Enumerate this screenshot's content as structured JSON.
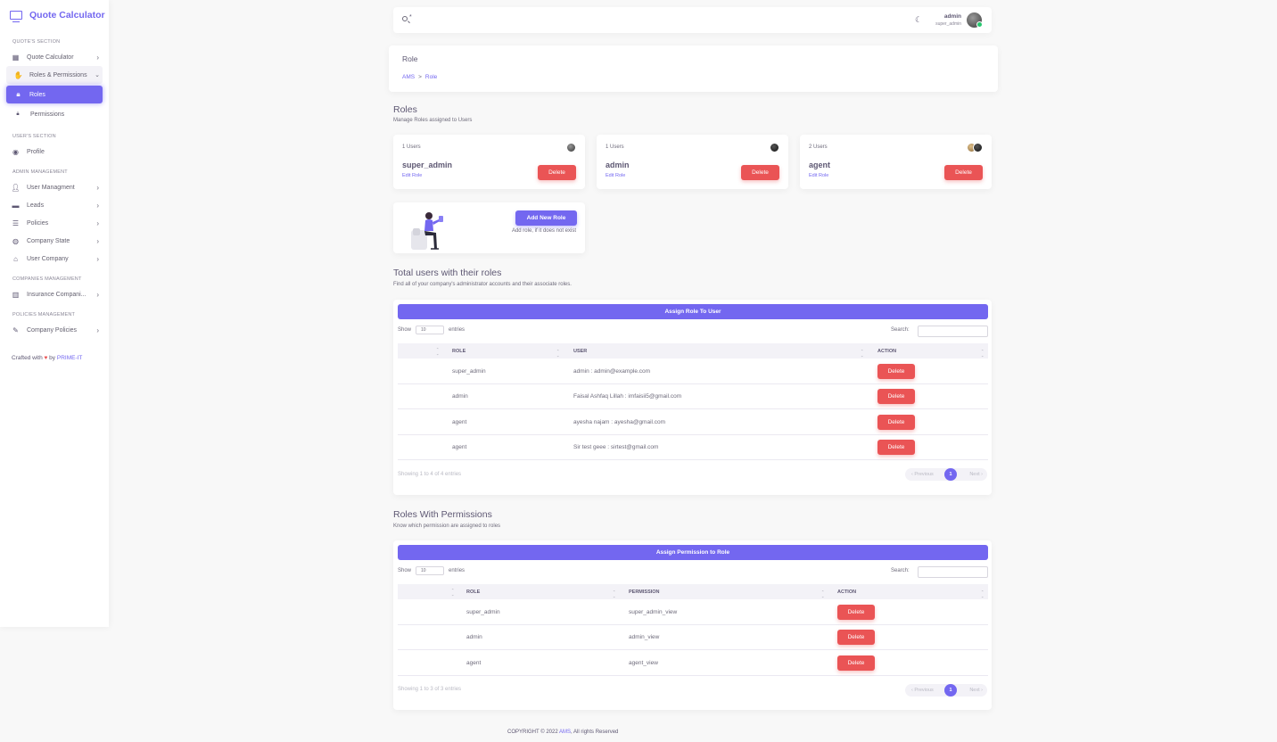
{
  "brand": {
    "title": "Quote Calculator"
  },
  "sidebar": {
    "quote_section": "QUOTE'S SECTION",
    "users_section": "USER'S SECTION",
    "admin_section": "ADMIN MANAGEMENT",
    "companies_section": "COMPANIES MANAGEMENT",
    "policies_section": "POLICIES MANAGEMENT",
    "items": {
      "quote_calculator": "Quote Calculator",
      "roles_permissions": "Roles & Permissions",
      "roles": "Roles",
      "permissions": "Permissions",
      "profile": "Profile",
      "user_management": "User Managment",
      "leads": "Leads",
      "policies": "Policies",
      "company_state": "Company State",
      "user_company": "User Company",
      "insurance_companies": "Insurance Compani...",
      "company_policies": "Company Policies"
    },
    "crafted_prefix": "Crafted with",
    "crafted_by": "by",
    "crafted_link": "PRIME-IT"
  },
  "navbar": {
    "star": "*",
    "user_name": "admin",
    "user_role": "super_admin"
  },
  "breadcrumb": {
    "title": "Role",
    "home": "AMS",
    "sep": ">",
    "current": "Role"
  },
  "roles_header": {
    "title": "Roles",
    "subtitle": "Manage Roles assigned to Users"
  },
  "role_cards": [
    {
      "count": "1 Users",
      "name": "super_admin",
      "edit": "Edit Role",
      "delete": "Delete"
    },
    {
      "count": "1 Users",
      "name": "admin",
      "edit": "Edit Role",
      "delete": "Delete"
    },
    {
      "count": "2 Users",
      "name": "agent",
      "edit": "Edit Role",
      "delete": "Delete"
    }
  ],
  "add_role": {
    "button": "Add New Role",
    "help": "Add role, if it does not exist"
  },
  "users_roles": {
    "title": "Total users with their roles",
    "subtitle": "Find all of your company's administrator accounts and their associate roles.",
    "assign_button": "Assign Role To User",
    "show": "Show",
    "entries_value": "10",
    "entries": "entries",
    "search": "Search:",
    "columns": [
      "ROLE",
      "USER",
      "ACTION"
    ],
    "rows": [
      {
        "role": "super_admin",
        "user": "admin : admin@example.com",
        "action": "Delete"
      },
      {
        "role": "admin",
        "user": "Faisal Ashfaq Lillah : imfaisii5@gmail.com",
        "action": "Delete"
      },
      {
        "role": "agent",
        "user": "ayesha najam : ayesha@gmail.com",
        "action": "Delete"
      },
      {
        "role": "agent",
        "user": "Sir test geee : sirtest@gmail.com",
        "action": "Delete"
      }
    ],
    "info": "Showing 1 to 4 of 4 entries",
    "prev": "‹ Previous",
    "page": "1",
    "next": "Next ›"
  },
  "roles_permissions": {
    "title": "Roles With Permissions",
    "subtitle": "Know which permission are assigned to roles",
    "assign_button": "Assign Permission to Role",
    "show": "Show",
    "entries_value": "10",
    "entries": "entries",
    "search": "Search:",
    "columns": [
      "ROLE",
      "PERMISSION",
      "ACTION"
    ],
    "rows": [
      {
        "role": "super_admin",
        "permission": "super_admin_view",
        "action": "Delete"
      },
      {
        "role": "admin",
        "permission": "admin_view",
        "action": "Delete"
      },
      {
        "role": "agent",
        "permission": "agent_view",
        "action": "Delete"
      }
    ],
    "info": "Showing 1 to 3 of 3 entries",
    "prev": "‹ Previous",
    "page": "1",
    "next": "Next ›"
  },
  "footer": {
    "prefix": "COPYRIGHT © 2022",
    "link": "AMS",
    "suffix": ", All rights Reserved"
  },
  "colors": {
    "primary": "#7367f0",
    "danger": "#ea5455",
    "success": "#28c76f"
  }
}
